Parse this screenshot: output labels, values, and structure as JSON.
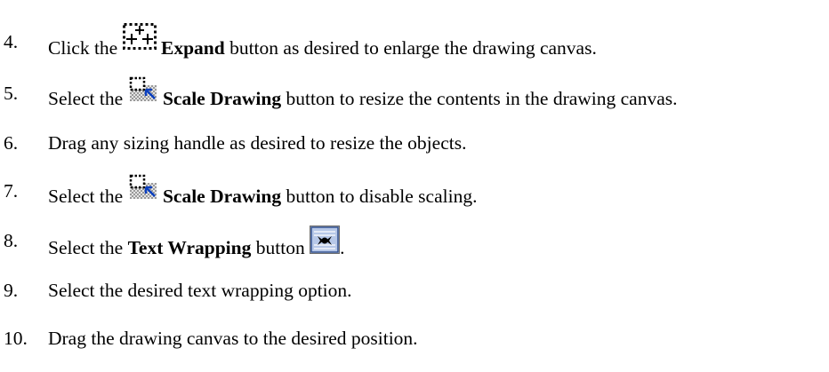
{
  "steps": [
    {
      "number": "4.",
      "before": "Click the",
      "icon": "expand-icon",
      "button": "Expand",
      "after": " button as desired to enlarge the drawing canvas."
    },
    {
      "number": "5.",
      "before": "Select the",
      "icon": "scale-drawing-icon",
      "button": "Scale Drawing",
      "after": " button to resize the contents in the drawing canvas."
    },
    {
      "number": "6.",
      "text": "Drag any sizing handle as desired to resize the objects."
    },
    {
      "number": "7.",
      "before": "Select the",
      "icon": "scale-drawing-icon",
      "button": "Scale Drawing",
      "after": " button to disable scaling."
    },
    {
      "number": "8.",
      "before": "Select the ",
      "button": "Text Wrapping",
      "after": " button",
      "icon": "text-wrapping-icon",
      "end": "."
    },
    {
      "number": "9.",
      "text": "Select the desired text wrapping option."
    },
    {
      "number": "10.",
      "text": "Drag the drawing canvas to the desired position."
    }
  ]
}
